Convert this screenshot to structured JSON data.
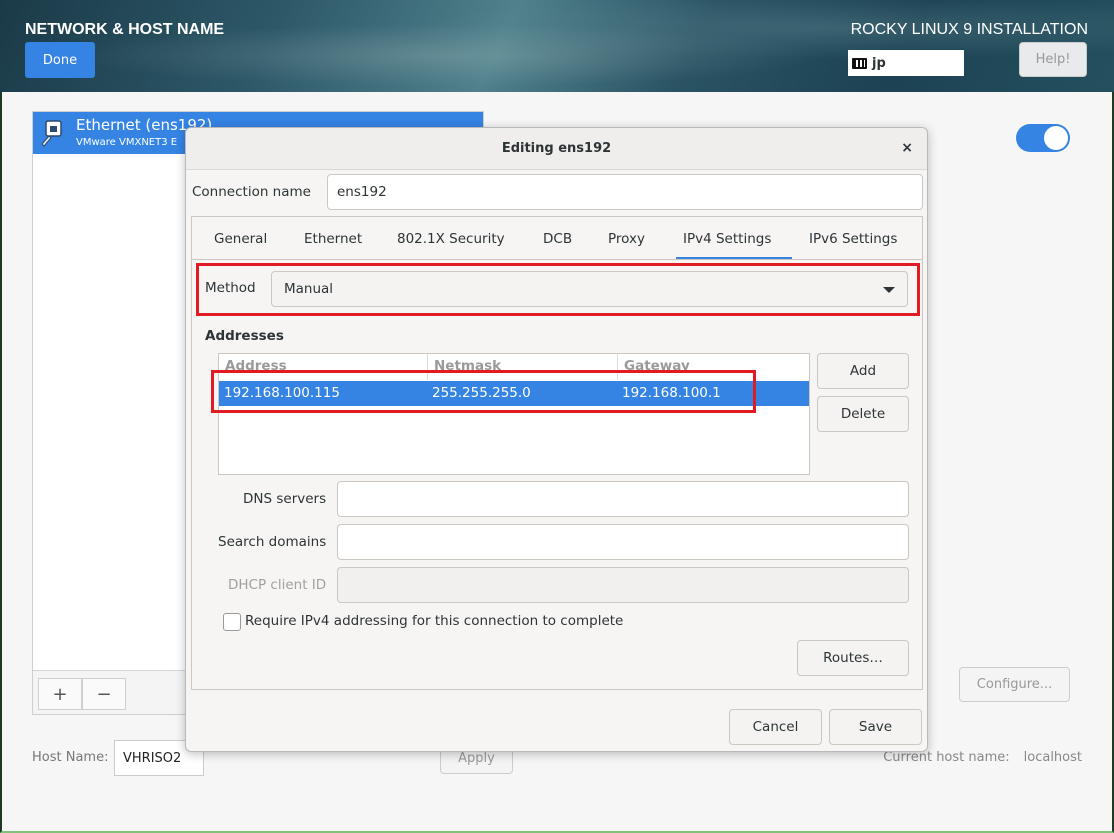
{
  "header": {
    "title": "NETWORK & HOST NAME",
    "install_title": "ROCKY LINUX 9 INSTALLATION",
    "done_label": "Done",
    "help_label": "Help!",
    "keyboard_layout": "jp"
  },
  "device_list": {
    "selected": {
      "name": "Ethernet (ens192)",
      "description": "VMware VMXNET3 E"
    },
    "add_label": "+",
    "remove_label": "−"
  },
  "device_panel": {
    "enabled": true,
    "configure_label": "Configure..."
  },
  "hostname": {
    "label": "Host Name:",
    "value": "VHRISO2",
    "apply_label": "Apply",
    "current_label": "Current host name:",
    "current_value": "localhost"
  },
  "dialog": {
    "title": "Editing ens192",
    "close_label": "×",
    "connection_name_label": "Connection name",
    "connection_name_value": "ens192",
    "tabs": [
      "General",
      "Ethernet",
      "802.1X Security",
      "DCB",
      "Proxy",
      "IPv4 Settings",
      "IPv6 Settings"
    ],
    "active_tab": "IPv4 Settings",
    "ipv4": {
      "method_label": "Method",
      "method_value": "Manual",
      "addresses_heading": "Addresses",
      "columns": [
        "Address",
        "Netmask",
        "Gateway"
      ],
      "rows": [
        {
          "address": "192.168.100.115",
          "netmask": "255.255.255.0",
          "gateway": "192.168.100.1"
        }
      ],
      "add_label": "Add",
      "delete_label": "Delete",
      "dns_label": "DNS servers",
      "dns_value": "",
      "search_label": "Search domains",
      "search_value": "",
      "dhcp_label": "DHCP client ID",
      "dhcp_value": "",
      "require_label": "Require IPv4 addressing for this connection to complete",
      "require_checked": false,
      "routes_label": "Routes…"
    },
    "cancel_label": "Cancel",
    "save_label": "Save"
  },
  "colors": {
    "accent": "#3584e4",
    "highlight": "#e01b24"
  }
}
